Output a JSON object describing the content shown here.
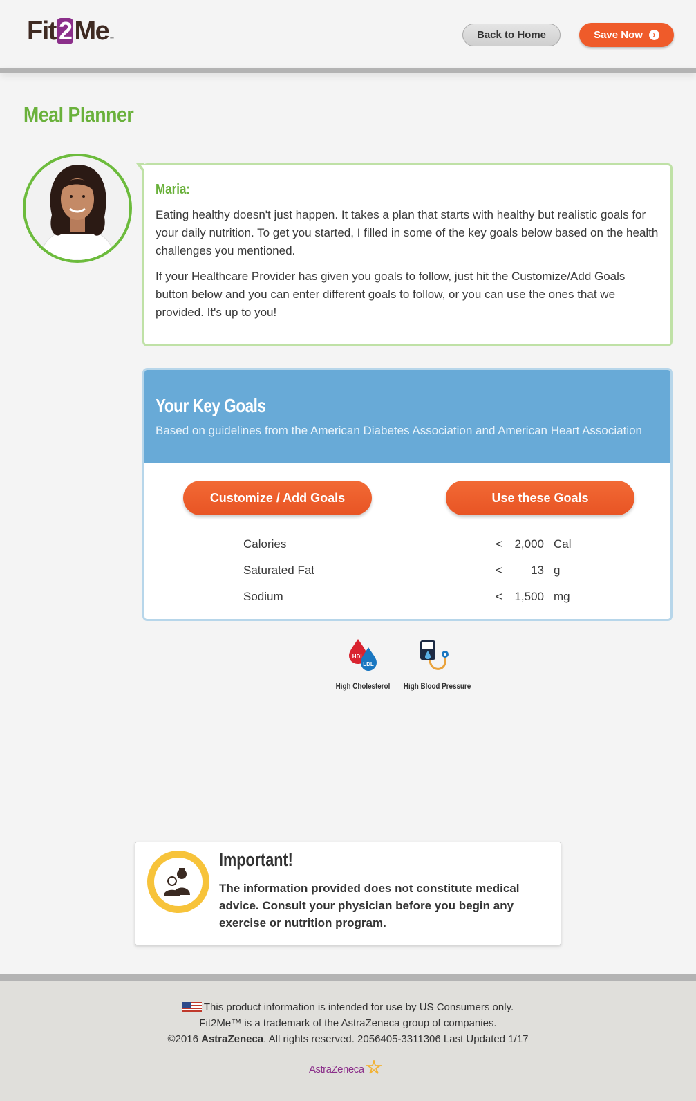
{
  "header": {
    "logo": {
      "part1": "Fit",
      "part2": "2",
      "part3": "Me",
      "tm": "™"
    },
    "back_home_label": "Back to Home",
    "save_now_label": "Save Now"
  },
  "page_title": "Meal Planner",
  "coach": {
    "name": "Maria:",
    "paragraph1": "Eating healthy doesn't just happen. It takes a plan that starts with healthy but realistic goals for your daily nutrition. To get you started, I filled in some of the key goals below based on the health challenges you mentioned.",
    "paragraph2": "If your Healthcare Provider has given you goals to follow, just hit the Customize/Add Goals button below and you can enter different goals to follow, or you can use the ones that we provided. It's up to you!"
  },
  "goals": {
    "title": "Your Key Goals",
    "subtitle": "Based on guidelines from the American Diabetes Association and American Heart Association",
    "customize_label": "Customize / Add Goals",
    "use_label": "Use these Goals",
    "rows": [
      {
        "label": "Calories",
        "cmp": "<",
        "value": "2,000",
        "unit": "Cal"
      },
      {
        "label": "Saturated Fat",
        "cmp": "<",
        "value": "13",
        "unit": "g"
      },
      {
        "label": "Sodium",
        "cmp": "<",
        "value": "1,500",
        "unit": "mg"
      }
    ]
  },
  "conditions": [
    {
      "label": "High Cholesterol",
      "icon": "cholesterol-drops-icon",
      "hdl": "HDL",
      "ldl": "LDL"
    },
    {
      "label": "High Blood Pressure",
      "icon": "blood-pressure-cuff-icon"
    }
  ],
  "important": {
    "title": "Important!",
    "text": "The information provided does not constitute medical advice. Consult your physician before you begin any exercise or nutrition program.",
    "icon": "doctor-patient-icon"
  },
  "footer": {
    "line1": "This product information is intended for use by US Consumers only.",
    "line2": "Fit2Me™ is a trademark of the AstraZeneca group of companies.",
    "line3_prefix": "©2016 ",
    "line3_brand": "AstraZeneca",
    "line3_suffix": ". All rights reserved. 2056405-3311306 Last Updated 1/17",
    "brand_logo": "AstraZeneca"
  },
  "colors": {
    "accent_green": "#6ab13b",
    "accent_orange": "#ef5b2a",
    "goals_blue": "#68aad7",
    "brand_purple": "#8b2f8a"
  }
}
